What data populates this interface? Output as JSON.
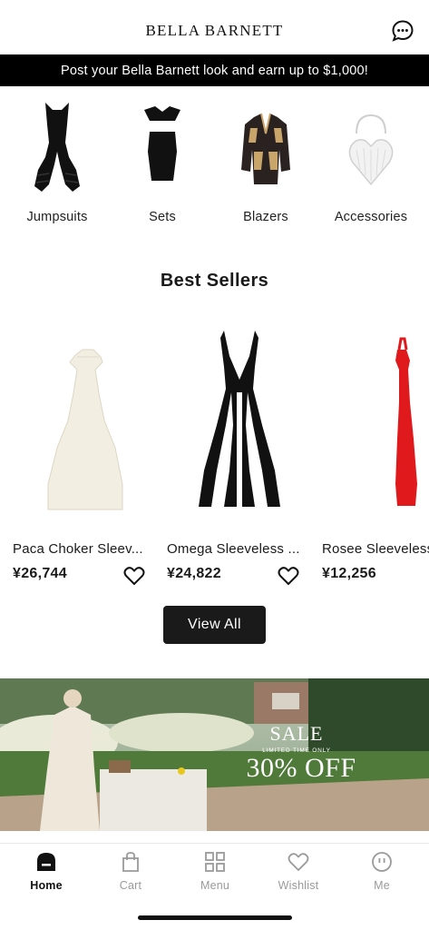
{
  "header": {
    "brand": "BELLA BARNETT",
    "chat_icon": "chat-bubble-icon"
  },
  "promo": {
    "text": "Post your Bella Barnett look and earn up to $1,000!"
  },
  "categories": [
    {
      "label": "Jumpsuits",
      "icon": "jumpsuit-image"
    },
    {
      "label": "Sets",
      "icon": "set-image"
    },
    {
      "label": "Blazers",
      "icon": "blazer-image"
    },
    {
      "label": "Accessories",
      "icon": "heart-bag-image"
    }
  ],
  "best_sellers": {
    "title": "Best Sellers",
    "products": [
      {
        "name": "Paca Choker Sleev...",
        "price": "¥26,744",
        "color": "#f3efe4"
      },
      {
        "name": "Omega Sleeveless ...",
        "price": "¥24,822",
        "color": "#111111"
      },
      {
        "name": "Rosee Sleeveless",
        "price": "¥12,256",
        "color": "#e0191c"
      }
    ],
    "view_all": "View All"
  },
  "banner": {
    "sale": "SALE",
    "limited": "LIMITED TIME ONLY",
    "discount": "30% OFF"
  },
  "nav": {
    "items": [
      {
        "label": "Home",
        "icon": "home-icon",
        "active": true
      },
      {
        "label": "Cart",
        "icon": "bag-icon",
        "active": false
      },
      {
        "label": "Menu",
        "icon": "grid-icon",
        "active": false
      },
      {
        "label": "Wishlist",
        "icon": "heart-icon",
        "active": false
      },
      {
        "label": "Me",
        "icon": "face-icon",
        "active": false
      }
    ]
  }
}
